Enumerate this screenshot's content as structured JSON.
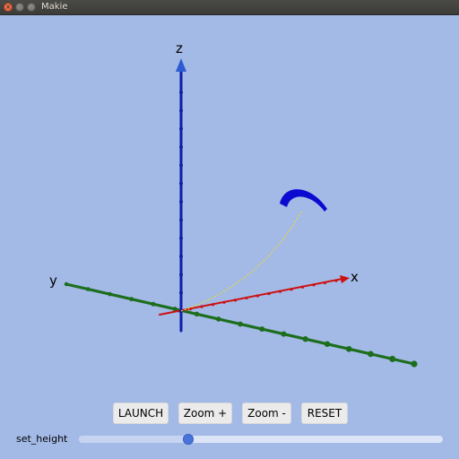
{
  "window": {
    "title": "Makie"
  },
  "scene": {
    "axes": {
      "x_label": "x",
      "y_label": "y",
      "z_label": "z"
    },
    "colors": {
      "background": "#a3b9e6",
      "x_axis": "#cc1111",
      "y_axis": "#1c6e1c",
      "z_axis": "#0a1fa8",
      "trajectory": "#e8dc2a",
      "projectile": "#0a0ad0"
    }
  },
  "controls": {
    "buttons": [
      {
        "label": "LAUNCH"
      },
      {
        "label": "Zoom +"
      },
      {
        "label": "Zoom -"
      },
      {
        "label": "RESET"
      }
    ],
    "slider": {
      "label": "set_height",
      "value_fraction": 0.3
    }
  }
}
